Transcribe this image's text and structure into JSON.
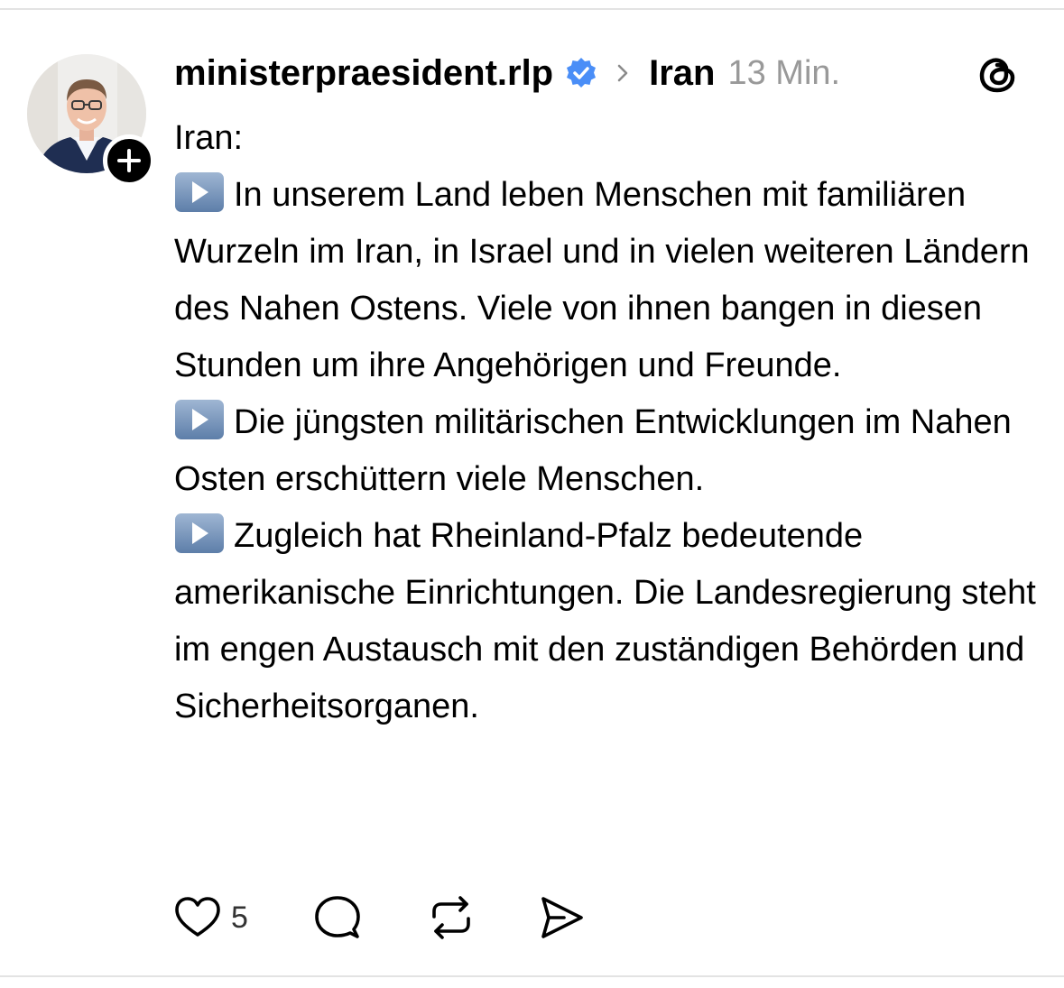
{
  "post": {
    "username": "ministerpraesident.rlp",
    "topic": "Iran",
    "timestamp": "13 Min.",
    "paragraphs": [
      {
        "emoji": false,
        "text": "Iran:"
      },
      {
        "emoji": true,
        "text": "In unserem Land leben Menschen mit familiären Wurzeln im Iran, in Israel und in vielen weiteren Ländern des Nahen Ostens. Viele von ihnen bangen in diesen Stunden um ihre Angehörigen und Freunde."
      },
      {
        "emoji": true,
        "text": "Die jüngsten militärischen Entwicklungen im Nahen Osten erschüttern viele Menschen."
      },
      {
        "emoji": true,
        "text": "Zugleich hat Rheinland-Pfalz bedeutende amerikanische Einrichtungen. Die Landesregierung steht im engen Austausch mit den zuständigen Behörden und Sicherheitsorganen."
      }
    ],
    "like_count": "5"
  },
  "icons": {
    "verified": "verified-badge-icon",
    "chevron": "chevron-right-icon",
    "threads": "threads-logo-icon",
    "follow": "plus-icon",
    "like": "heart-icon",
    "reply": "comment-bubble-icon",
    "repost": "repost-icon",
    "share": "send-icon",
    "bullet": "play-button-emoji"
  },
  "colors": {
    "verified_blue": "#4a8ef7",
    "timestamp_gray": "#999999",
    "emoji_blue": "#6f8fb8"
  }
}
